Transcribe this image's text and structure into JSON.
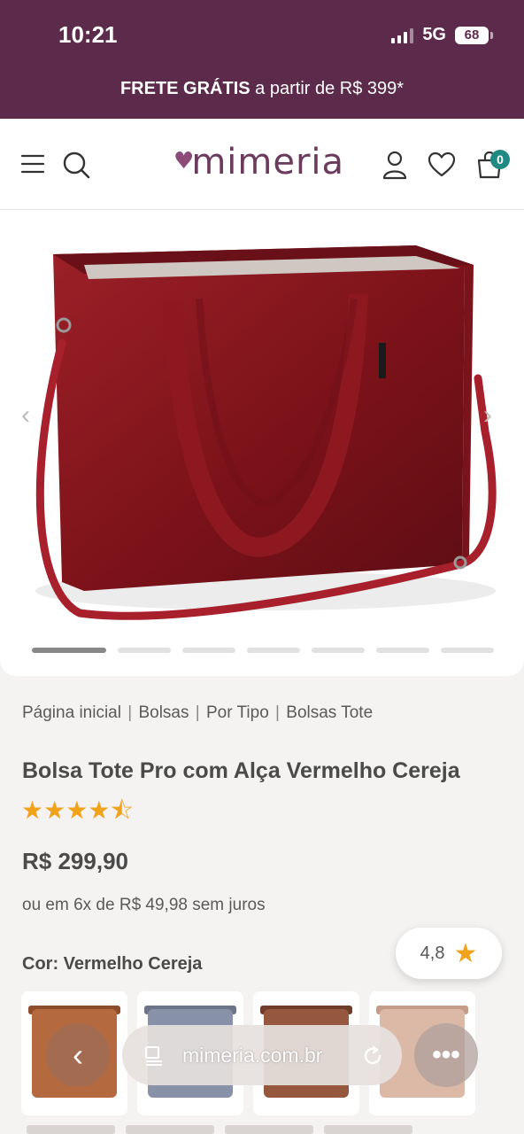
{
  "status": {
    "time": "10:21",
    "network": "5G",
    "battery": "68"
  },
  "promo": {
    "bold": "FRETE GRÁTIS",
    "rest": "a partir de R$ 399*"
  },
  "header": {
    "logo": "mimeria",
    "cart_count": "0",
    "icons": [
      "menu-icon",
      "search-icon",
      "user-icon",
      "heart-icon",
      "cart-icon"
    ]
  },
  "gallery": {
    "slides": 7,
    "active_slide": 1,
    "bag_color": "#8a1a22",
    "strap_color": "#9e1f2b"
  },
  "breadcrumb": [
    "Página inicial",
    "Bolsas",
    "Por Tipo",
    "Bolsas Tote"
  ],
  "product": {
    "title": "Bolsa Tote Pro com Alça Vermelho Cereja",
    "stars": "★★★★⯪",
    "rating_value": 4.5,
    "price": "R$ 299,90",
    "installments": "ou em 6x de R$ 49,98 sem juros",
    "color_label": "Cor: Vermelho Cereja"
  },
  "rating_pill": {
    "value": "4,8"
  },
  "swatches": [
    {
      "name": "caramelo",
      "color": "#b46a3e"
    },
    {
      "name": "cinza-azulado",
      "color": "#8792a8"
    },
    {
      "name": "marrom",
      "color": "#95573e"
    },
    {
      "name": "rose",
      "color": "#dcb8a6"
    }
  ],
  "browser": {
    "url": "mimeria.com.br"
  },
  "colors": {
    "brand": "#5c2a4a",
    "accent_badge": "#1f8a83",
    "star": "#f1a21b"
  }
}
